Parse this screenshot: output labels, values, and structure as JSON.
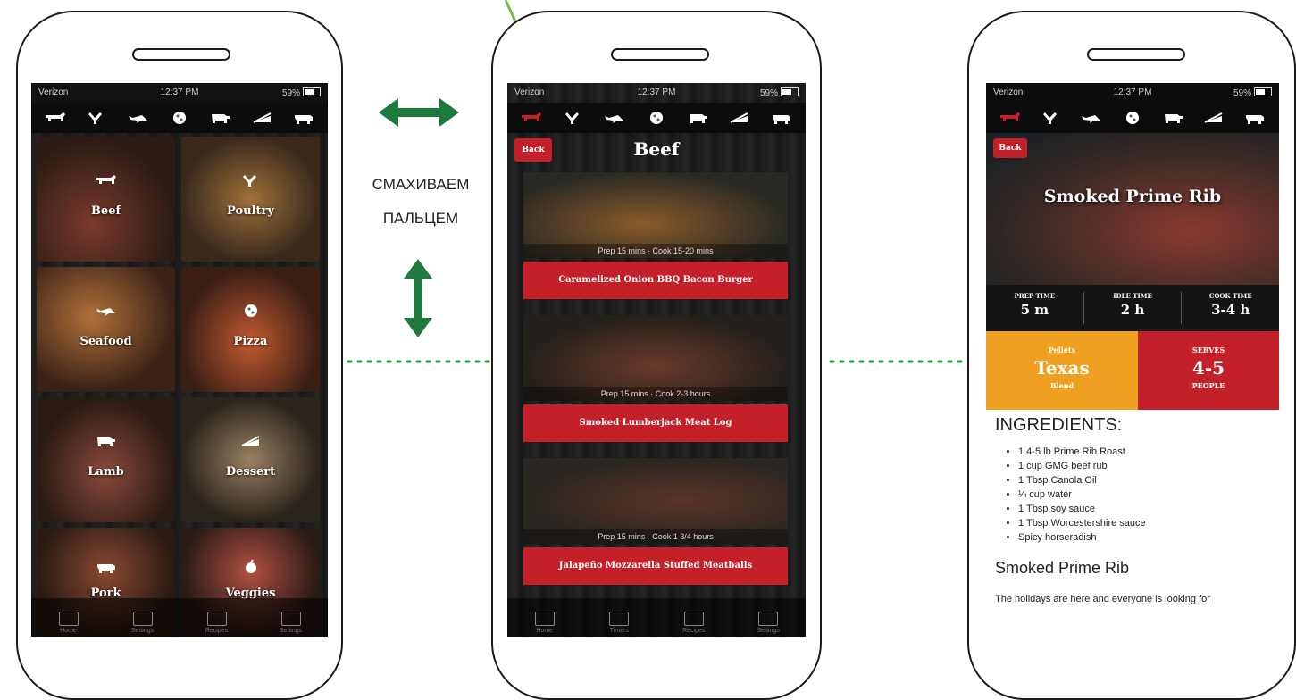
{
  "status": {
    "carrier": "Verizon",
    "time": "12:37 PM",
    "battery": "59%"
  },
  "categories": [
    "beef-icon",
    "poultry-icon",
    "seafood-icon",
    "pizza-icon",
    "lamb-icon",
    "dessert-icon",
    "pork-icon"
  ],
  "home": {
    "tiles": [
      "Beef",
      "Poultry",
      "Seafood",
      "Pizza",
      "Lamb",
      "Dessert",
      "Pork",
      "Veggies"
    ],
    "tabs": [
      "Home",
      "Settings",
      "Recipes",
      "Settings"
    ]
  },
  "annotation": {
    "line1": "СМАХИВАЕМ",
    "line2": "ПАЛЬЦЕМ"
  },
  "list": {
    "back": "Back",
    "title": "Beef",
    "recipes": [
      {
        "meta": "Prep 15 mins · Cook 15-20 mins",
        "name": "Caramelized Onion BBQ Bacon Burger"
      },
      {
        "meta": "Prep 15 mins · Cook 2-3 hours",
        "name": "Smoked Lumberjack Meat Log"
      },
      {
        "meta": "Prep 15 mins · Cook 1 3/4 hours",
        "name": "Jalapeño Mozzarella Stuffed Meatballs"
      }
    ],
    "tabs": [
      "Home",
      "Timers",
      "Recipes",
      "Settings"
    ]
  },
  "detail": {
    "back": "Back",
    "title": "Smoked Prime Rib",
    "times": [
      {
        "label": "PREP TIME",
        "value": "5 m"
      },
      {
        "label": "IDLE TIME",
        "value": "2 h"
      },
      {
        "label": "COOK TIME",
        "value": "3-4 h"
      }
    ],
    "pellets": {
      "top": "Pellets",
      "value": "Texas",
      "bottom": "Blend"
    },
    "serves": {
      "top": "SERVES",
      "value": "4-5",
      "bottom": "PEOPLE"
    },
    "ingredients_heading": "INGREDIENTS:",
    "ingredients": [
      "1 4-5 lb Prime Rib Roast",
      "1 cup GMG beef rub",
      "1 Tbsp Canola Oil",
      "¼ cup water",
      "1 Tbsp soy sauce",
      "1 Tbsp Worcestershire sauce",
      "Spicy horseradish"
    ],
    "subheading": "Smoked Prime Rib",
    "description": "The holidays are here and everyone is looking for"
  },
  "colors": {
    "accent_red": "#c4202a",
    "pellet_orange": "#f0a020",
    "annotation_green": "#1e7a3c",
    "pointer_green": "#6cbf4a"
  }
}
